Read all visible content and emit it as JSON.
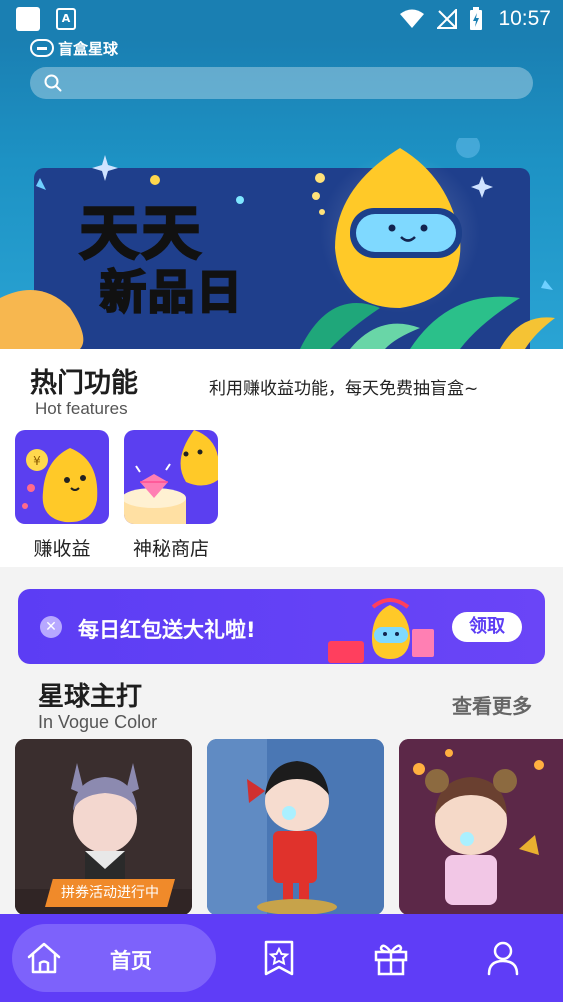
{
  "status_bar": {
    "time": "10:57"
  },
  "header": {
    "app_name": "盲盒星球",
    "search_placeholder": ""
  },
  "banner": {
    "line1": "天天",
    "line2": "新品日"
  },
  "hot_features": {
    "title": "热门功能",
    "subtitle": "Hot features",
    "description": "利用赚收益功能，每天免费抽盲盒~",
    "items": [
      {
        "label": "赚收益",
        "icon": "coin-blob-icon"
      },
      {
        "label": "神秘商店",
        "icon": "diamond-blob-icon"
      }
    ]
  },
  "promo": {
    "text": "每日红包送大礼啦!",
    "button": "领取"
  },
  "vogue": {
    "title": "星球主打",
    "subtitle": "In Vogue Color",
    "more": "查看更多",
    "products": [
      {
        "tag": "拼券活动进行中"
      },
      {
        "tag": ""
      },
      {
        "tag": ""
      }
    ]
  },
  "bottom_nav": {
    "items": [
      {
        "label": "首页",
        "icon": "home-icon",
        "active": true
      },
      {
        "label": "",
        "icon": "collection-icon",
        "active": false
      },
      {
        "label": "",
        "icon": "gift-icon",
        "active": false
      },
      {
        "label": "",
        "icon": "profile-icon",
        "active": false
      }
    ]
  },
  "colors": {
    "header_blue": "#1a7fb2",
    "accent_purple": "#5f3df7",
    "tag_orange": "#f08a2a"
  }
}
